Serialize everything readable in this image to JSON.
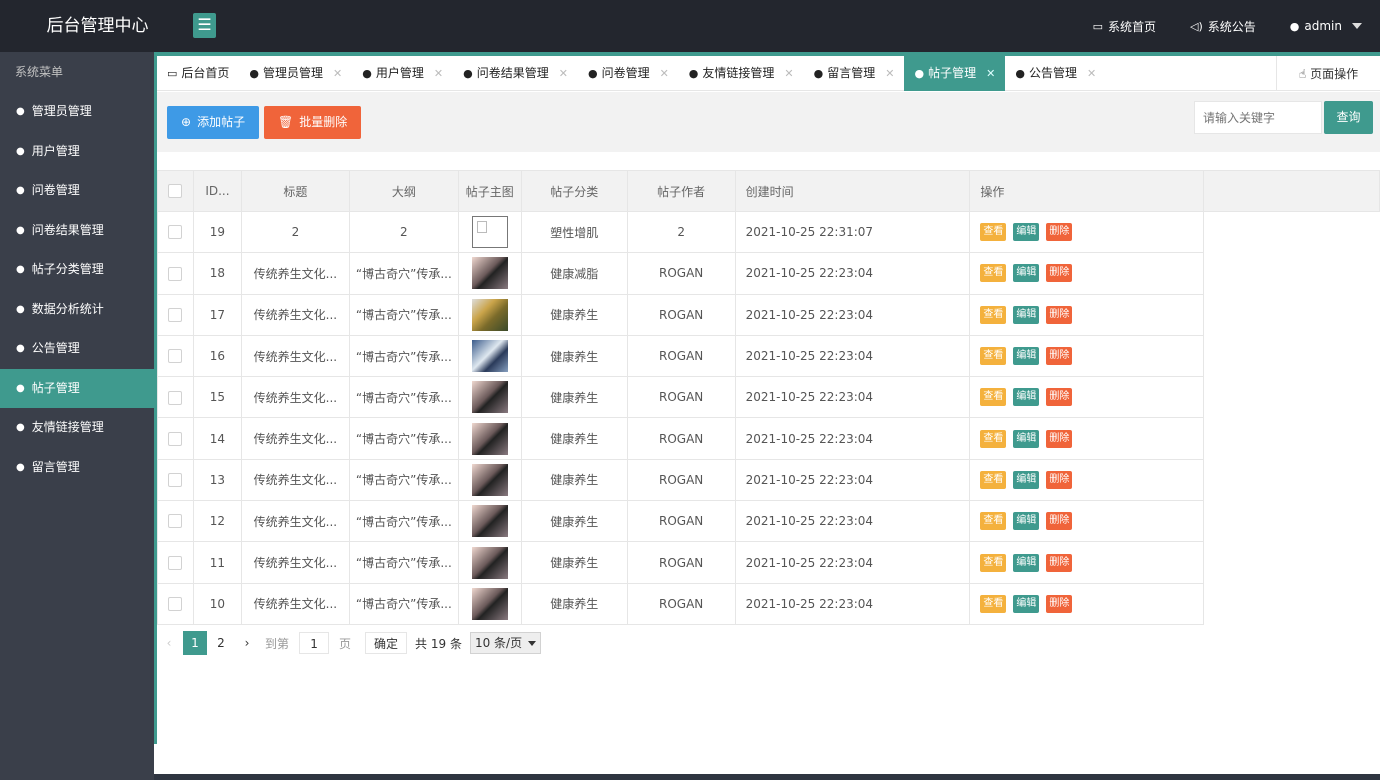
{
  "header": {
    "logo": "后台管理中心",
    "menu_toggle": "☰",
    "nav": [
      {
        "label": "系统首页"
      },
      {
        "label": "系统公告"
      },
      {
        "label": "admin"
      }
    ]
  },
  "sidebar": {
    "title": "系统菜单",
    "items": [
      {
        "label": "管理员管理"
      },
      {
        "label": "用户管理"
      },
      {
        "label": "问卷管理"
      },
      {
        "label": "问卷结果管理"
      },
      {
        "label": "帖子分类管理"
      },
      {
        "label": "数据分析统计"
      },
      {
        "label": "公告管理"
      },
      {
        "label": "帖子管理",
        "active": true
      },
      {
        "label": "友情链接管理"
      },
      {
        "label": "留言管理"
      }
    ]
  },
  "tabs": [
    {
      "label": "后台首页"
    },
    {
      "label": "管理员管理"
    },
    {
      "label": "用户管理"
    },
    {
      "label": "问卷结果管理"
    },
    {
      "label": "问卷管理"
    },
    {
      "label": "友情链接管理"
    },
    {
      "label": "留言管理"
    },
    {
      "label": "帖子管理",
      "active": true
    },
    {
      "label": "公告管理"
    }
  ],
  "page_ops_label": "页面操作",
  "toolbar": {
    "add_label": "添加帖子",
    "batch_delete_label": "批量删除",
    "search_placeholder": "请输入关键字",
    "search_button": "查询"
  },
  "table": {
    "columns": [
      "ID...",
      "标题",
      "大纲",
      "帖子主图",
      "帖子分类",
      "帖子作者",
      "创建时间",
      "操作"
    ],
    "actions": {
      "view": "查看",
      "edit": "编辑",
      "delete": "删除"
    },
    "rows": [
      {
        "id": "19",
        "title": "2",
        "outline": "2",
        "image": "broken",
        "category": "塑性增肌",
        "author": "2",
        "created": "2021-10-25 22:31:07"
      },
      {
        "id": "18",
        "title": "传统养生文化...",
        "outline": "“博古奇穴”传承...",
        "image": "p1",
        "category": "健康减脂",
        "author": "ROGAN",
        "created": "2021-10-25 22:23:04"
      },
      {
        "id": "17",
        "title": "传统养生文化...",
        "outline": "“博古奇穴”传承...",
        "image": "p2",
        "category": "健康养生",
        "author": "ROGAN",
        "created": "2021-10-25 22:23:04"
      },
      {
        "id": "16",
        "title": "传统养生文化...",
        "outline": "“博古奇穴”传承...",
        "image": "p3",
        "category": "健康养生",
        "author": "ROGAN",
        "created": "2021-10-25 22:23:04"
      },
      {
        "id": "15",
        "title": "传统养生文化...",
        "outline": "“博古奇穴”传承...",
        "image": "p1",
        "category": "健康养生",
        "author": "ROGAN",
        "created": "2021-10-25 22:23:04"
      },
      {
        "id": "14",
        "title": "传统养生文化...",
        "outline": "“博古奇穴”传承...",
        "image": "p1",
        "category": "健康养生",
        "author": "ROGAN",
        "created": "2021-10-25 22:23:04"
      },
      {
        "id": "13",
        "title": "传统养生文化...",
        "outline": "“博古奇穴”传承...",
        "image": "p1",
        "category": "健康养生",
        "author": "ROGAN",
        "created": "2021-10-25 22:23:04"
      },
      {
        "id": "12",
        "title": "传统养生文化...",
        "outline": "“博古奇穴”传承...",
        "image": "p1",
        "category": "健康养生",
        "author": "ROGAN",
        "created": "2021-10-25 22:23:04"
      },
      {
        "id": "11",
        "title": "传统养生文化...",
        "outline": "“博古奇穴”传承...",
        "image": "p1",
        "category": "健康养生",
        "author": "ROGAN",
        "created": "2021-10-25 22:23:04"
      },
      {
        "id": "10",
        "title": "传统养生文化...",
        "outline": "“博古奇穴”传承...",
        "image": "p1",
        "category": "健康养生",
        "author": "ROGAN",
        "created": "2021-10-25 22:23:04"
      }
    ]
  },
  "pager": {
    "pages": [
      "1",
      "2"
    ],
    "current": "1",
    "goto_label": "到第",
    "goto_value": "1",
    "page_unit": "页",
    "confirm": "确定",
    "total": "共 19 条",
    "page_size": "10 条/页"
  },
  "colors": {
    "accent": "#3f9a8e",
    "header_bg": "#23262e",
    "sidebar_bg": "#3a3f4a",
    "add_button": "#3e9ae6",
    "delete_button": "#f0643a",
    "view_button": "#f4b13d"
  }
}
